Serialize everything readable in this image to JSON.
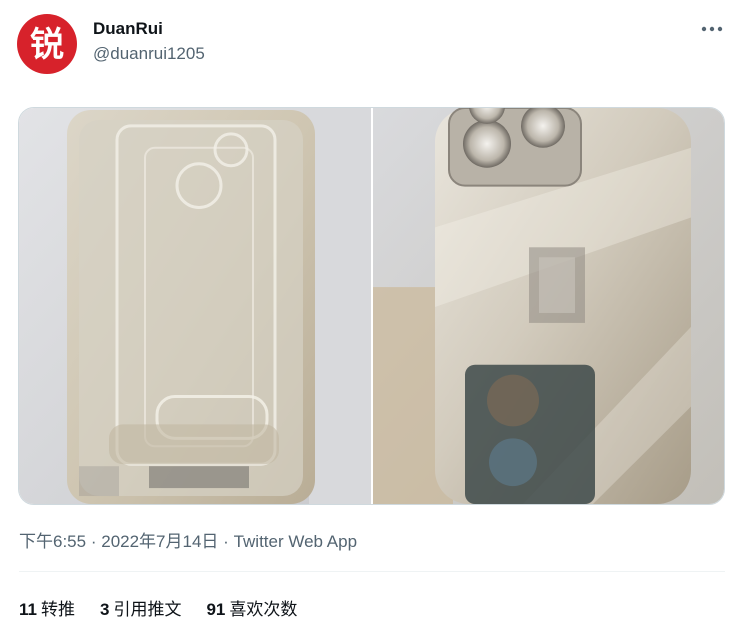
{
  "author": {
    "display_name": "DuanRui",
    "handle": "@duanrui1205",
    "avatar_glyph": "锐",
    "avatar_color": "#d7222b"
  },
  "more_icon": "more-horizontal-icon",
  "media": {
    "photos": [
      {
        "description_icon": "image-icon"
      },
      {
        "description_icon": "image-icon"
      }
    ]
  },
  "meta": {
    "time": "下午6:55",
    "separator": "·",
    "date": "2022年7月14日",
    "source": "Twitter Web App"
  },
  "stats": {
    "retweets_count": "11",
    "retweets_label": "转推",
    "quotes_count": "3",
    "quotes_label": "引用推文",
    "likes_count": "91",
    "likes_label": "喜欢次数"
  },
  "colors": {
    "text_primary": "#0f1419",
    "text_secondary": "#536471",
    "border": "#cfd9de",
    "divider": "#eff3f4"
  }
}
